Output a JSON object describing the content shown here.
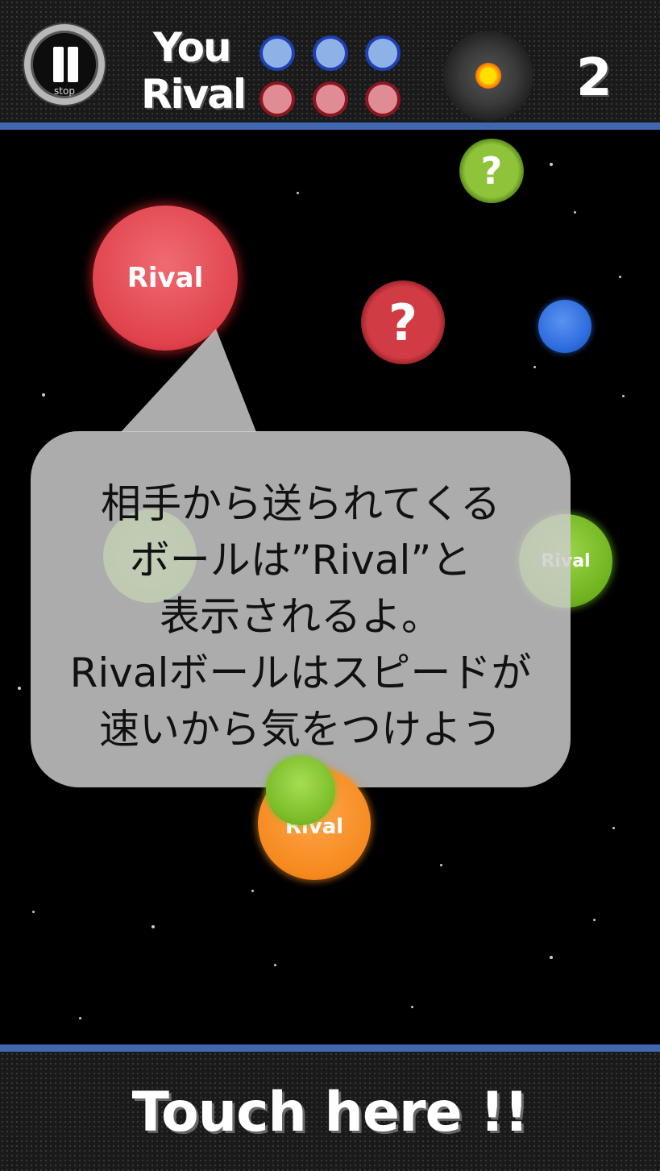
{
  "hud": {
    "pause_label": "stop",
    "you_label": "You",
    "rival_label": "Rival",
    "you_lives": 3,
    "rival_lives": 3,
    "score": "2",
    "target_icon": "fireball-icon"
  },
  "balls": {
    "rival_red_label": "Rival",
    "question_red_label": "?",
    "question_green_label": "?",
    "rival_green_label": "Rival",
    "rival_orange_label": "Rival"
  },
  "tutorial": {
    "lines": [
      "相手から送られてくる",
      "ボールは”Rival”と",
      "表示されるよ。",
      "Rivalボールはスピードが",
      "速いから気をつけよう"
    ]
  },
  "footer": {
    "touch_label": "Touch here !!"
  },
  "colors": {
    "accent_line": "#3f68b0",
    "you_dot": "#8fb2e6",
    "rival_dot": "#e08c95"
  }
}
